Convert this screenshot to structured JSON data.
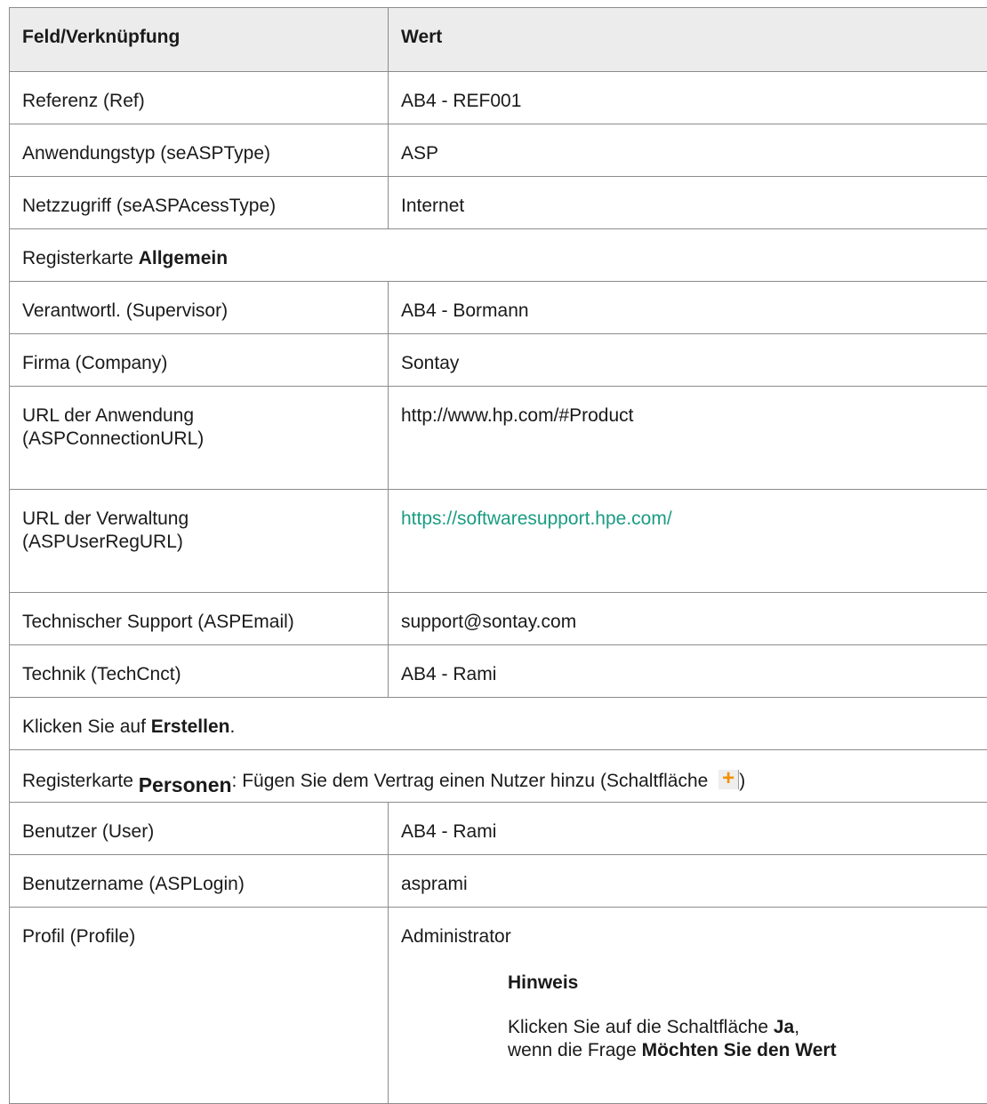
{
  "header": {
    "col1": "Feld/Verknüpfung",
    "col2": "Wert"
  },
  "rows1": [
    {
      "field": "Referenz (Ref)",
      "value": "AB4 - REF001"
    },
    {
      "field": "Anwendungstyp (seASPType)",
      "value": "ASP"
    },
    {
      "field": "Netzzugriff (seASPAcessType)",
      "value": "Internet"
    }
  ],
  "section_general": {
    "prefix": "Registerkarte ",
    "bold": "Allgemein"
  },
  "rows2": [
    {
      "field": "Verantwortl. (Supervisor)",
      "value": "AB4 - Bormann"
    },
    {
      "field": "Firma (Company)",
      "value": "Sontay"
    },
    {
      "field_line1": "URL der Anwendung",
      "field_line2": "(ASPConnectionURL)",
      "value": "http://www.hp.com/#Product"
    },
    {
      "field_line1": "URL der Verwaltung",
      "field_line2": "(ASPUserRegURL)",
      "value": "https://softwaresupport.hpe.com/"
    },
    {
      "field": "Technischer Support (ASPEmail)",
      "value": "support@sontay.com"
    },
    {
      "field": "Technik (TechCnct)",
      "value": "AB4 - Rami"
    }
  ],
  "section_create": {
    "prefix": "Klicken Sie auf ",
    "bold": "Erstellen",
    "suffix": "."
  },
  "section_persons": {
    "prefix": "Registerkarte ",
    "bold": "Personen",
    "text": ": Fügen Sie dem Vertrag einen Nutzer hinzu (Schaltfläche ",
    "suffix": ")",
    "icon": "add-icon"
  },
  "rows3": [
    {
      "field": "Benutzer (User)",
      "value": "AB4 - Rami"
    },
    {
      "field": "Benutzername (ASPLogin)",
      "value": "asprami"
    },
    {
      "field": "Profil (Profile)",
      "value": "Administrator"
    }
  ],
  "note": {
    "title": "Hinweis",
    "line1_prefix": "Klicken Sie auf die Schaltfläche ",
    "line1_bold": "Ja",
    "line1_suffix": ",",
    "line2_prefix": "wenn die Frage ",
    "line2_bold": "Möchten Sie den Wert"
  },
  "colors": {
    "header_bg": "#ececec",
    "border": "#8c8c8c",
    "link": "#1a9c83",
    "icon_plus": "#f29100"
  }
}
